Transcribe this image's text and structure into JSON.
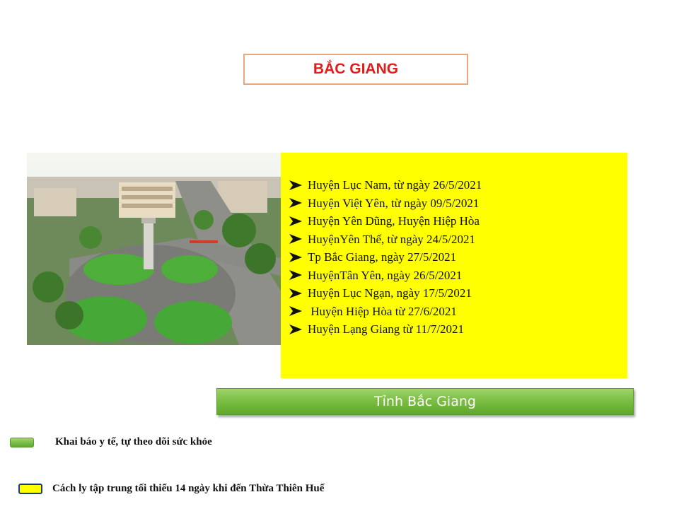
{
  "title": "BẮC GIANG",
  "districts": [
    "Huyện Lục Nam,  từ ngày  26/5/2021",
    "Huyện Việt Yên, từ ngày  09/5/2021",
    "Huyện Yên Dũng, Huyện Hiệp Hòa",
    "HuyệnYên Thế,   từ ngày  24/5/2021",
    "Tp Bắc Giang,  ngày  27/5/2021",
    "HuyệnTân  Yên,  ngày  26/5/2021",
    "Huyện Lục Ngạn, ngày  17/5/2021",
    " Huyện Hiệp Hòa từ 27/6/2021",
    "Huyện Lạng Giang từ 11/7/2021"
  ],
  "province_label": "Tỉnh Bắc Giang",
  "legend": {
    "green_text": "Khai báo y tế, tự theo dõi sức khỏe",
    "yellow_text": "Cách ly tập trung  tối thiểu 14  ngày khi đến Thừa Thiên Huế"
  },
  "colors": {
    "title_red": "#e31b1b",
    "panel_yellow": "#ffff00",
    "bar_green": "#7cbf44"
  }
}
